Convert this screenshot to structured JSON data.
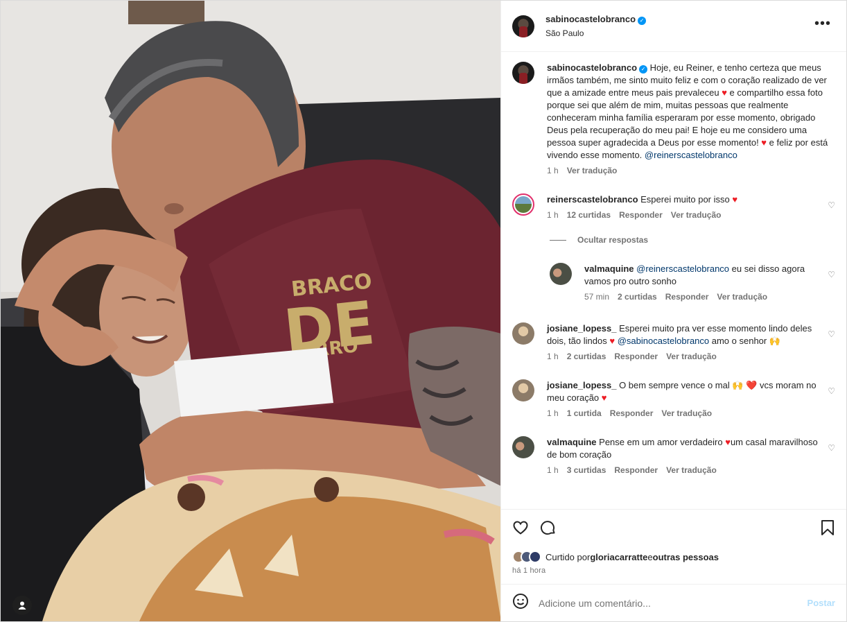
{
  "post": {
    "username": "sabinocastelobranco",
    "location": "São Paulo",
    "caption": {
      "username": "sabinocastelobranco",
      "text_1": " Hoje, eu Reiner, e tenho certeza que meus irmãos também, me sinto muito feliz e com o coração realizado de ver que a amizade entre meus pais prevaleceu ",
      "text_2": " e compartilho essa foto porque sei que além de mim, muitas pessoas que realmente conheceram minha família esperaram por esse momento, obrigado Deus pela recuperação do meu pai! E hoje eu me considero uma pessoa super agradecida a Deus por esse momento! ",
      "text_3": " e feliz por está vivendo esse momento.",
      "mention": "@reinerscastelobranco",
      "time": "1 h",
      "translate": "Ver tradução"
    },
    "shirt_text_top": "BRACO",
    "shirt_text_mid": "DE",
    "shirt_text_bot": "FERRO"
  },
  "comments": [
    {
      "username": "reinerscastelobranco",
      "text": " Esperei muito por isso ",
      "emoji": "❤️",
      "time": "1 h",
      "likes": "12 curtidas",
      "reply": "Responder",
      "translate": "Ver tradução"
    },
    {
      "username": "valmaquine",
      "mention": "@reinerscastelobranco",
      "text": " eu sei disso agora vamos pro outro sonho",
      "time": "57 min",
      "likes": "2 curtidas",
      "reply": "Responder",
      "translate": "Ver tradução"
    },
    {
      "username": "josiane_lopess_",
      "text": " Esperei muito pra ver esse momento lindo deles dois, tão lindos ",
      "emoji": "❤️",
      "mention": "@sabinocastelobranco",
      "text_2": " amo o senhor",
      "emoji_2": "🙌",
      "time": "1 h",
      "likes": "2 curtidas",
      "reply": "Responder",
      "translate": "Ver tradução"
    },
    {
      "username": "josiane_lopess_",
      "text": " O bem sempre vence o mal ",
      "emoji": "🙌 ❤️",
      "text_2": " vcs moram no meu coração ",
      "emoji_2": "❤️",
      "time": "1 h",
      "likes": "1 curtida",
      "reply": "Responder",
      "translate": "Ver tradução"
    },
    {
      "username": "valmaquine",
      "text": " Pense em um amor verdadeiro ",
      "emoji": "❤️",
      "text_2": "um casal maravilhoso de bom coração",
      "time": "1 h",
      "likes": "3 curtidas",
      "reply": "Responder",
      "translate": "Ver tradução"
    }
  ],
  "hide_replies": "Ocultar respostas",
  "liked_by": {
    "prefix": "Curtido por ",
    "user": "gloriacarratte",
    "middle": " e ",
    "others": "outras pessoas"
  },
  "time_ago": "há 1 hora",
  "add_comment": {
    "placeholder": "Adicione um comentário...",
    "post": "Postar"
  },
  "icons": {
    "more": "more-options-icon",
    "like": "heart-icon",
    "comment": "comment-icon",
    "save": "bookmark-icon",
    "emoji": "emoji-icon",
    "user_tag": "user-tag-icon"
  },
  "colors": {
    "link": "#00376b",
    "verified": "#0095f6",
    "heart": "#ed1c24",
    "post_disabled": "#b2dffc"
  }
}
